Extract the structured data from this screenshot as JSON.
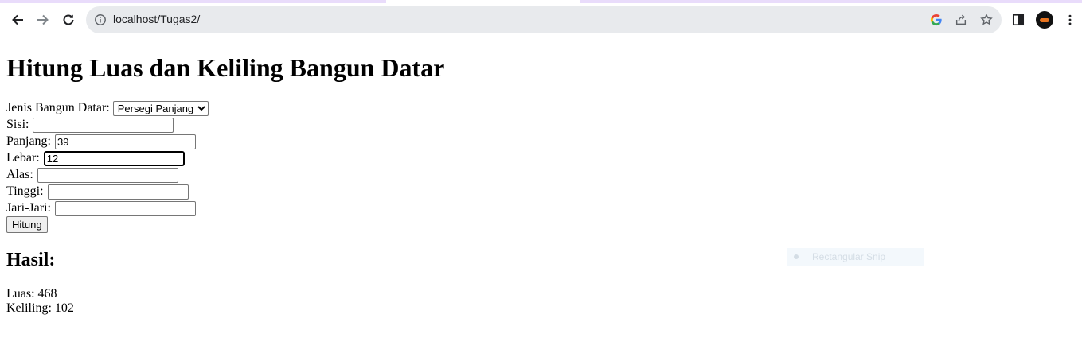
{
  "browser": {
    "url": "localhost/Tugas2/"
  },
  "page": {
    "title": "Hitung Luas dan Keliling Bangun Datar",
    "form": {
      "jenis_label": "Jenis Bangun Datar:",
      "jenis_selected": "Persegi Panjang",
      "fields": [
        {
          "label": "Sisi:",
          "value": ""
        },
        {
          "label": "Panjang:",
          "value": "39"
        },
        {
          "label": "Lebar:",
          "value": "12"
        },
        {
          "label": "Alas:",
          "value": ""
        },
        {
          "label": "Tinggi:",
          "value": ""
        },
        {
          "label": "Jari-Jari:",
          "value": ""
        }
      ],
      "submit_label": "Hitung"
    },
    "result": {
      "heading": "Hasil:",
      "luas": "Luas: 468",
      "keliling": "Keliling: 102"
    }
  },
  "overlay": {
    "snip_label": "Rectangular Snip"
  }
}
